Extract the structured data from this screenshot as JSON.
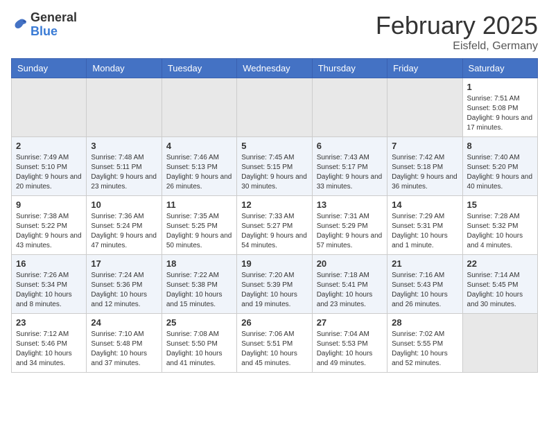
{
  "header": {
    "logo_general": "General",
    "logo_blue": "Blue",
    "month_title": "February 2025",
    "location": "Eisfeld, Germany"
  },
  "calendar": {
    "headers": [
      "Sunday",
      "Monday",
      "Tuesday",
      "Wednesday",
      "Thursday",
      "Friday",
      "Saturday"
    ],
    "weeks": [
      [
        {
          "day": "",
          "info": ""
        },
        {
          "day": "",
          "info": ""
        },
        {
          "day": "",
          "info": ""
        },
        {
          "day": "",
          "info": ""
        },
        {
          "day": "",
          "info": ""
        },
        {
          "day": "",
          "info": ""
        },
        {
          "day": "1",
          "info": "Sunrise: 7:51 AM\nSunset: 5:08 PM\nDaylight: 9 hours and 17 minutes."
        }
      ],
      [
        {
          "day": "2",
          "info": "Sunrise: 7:49 AM\nSunset: 5:10 PM\nDaylight: 9 hours and 20 minutes."
        },
        {
          "day": "3",
          "info": "Sunrise: 7:48 AM\nSunset: 5:11 PM\nDaylight: 9 hours and 23 minutes."
        },
        {
          "day": "4",
          "info": "Sunrise: 7:46 AM\nSunset: 5:13 PM\nDaylight: 9 hours and 26 minutes."
        },
        {
          "day": "5",
          "info": "Sunrise: 7:45 AM\nSunset: 5:15 PM\nDaylight: 9 hours and 30 minutes."
        },
        {
          "day": "6",
          "info": "Sunrise: 7:43 AM\nSunset: 5:17 PM\nDaylight: 9 hours and 33 minutes."
        },
        {
          "day": "7",
          "info": "Sunrise: 7:42 AM\nSunset: 5:18 PM\nDaylight: 9 hours and 36 minutes."
        },
        {
          "day": "8",
          "info": "Sunrise: 7:40 AM\nSunset: 5:20 PM\nDaylight: 9 hours and 40 minutes."
        }
      ],
      [
        {
          "day": "9",
          "info": "Sunrise: 7:38 AM\nSunset: 5:22 PM\nDaylight: 9 hours and 43 minutes."
        },
        {
          "day": "10",
          "info": "Sunrise: 7:36 AM\nSunset: 5:24 PM\nDaylight: 9 hours and 47 minutes."
        },
        {
          "day": "11",
          "info": "Sunrise: 7:35 AM\nSunset: 5:25 PM\nDaylight: 9 hours and 50 minutes."
        },
        {
          "day": "12",
          "info": "Sunrise: 7:33 AM\nSunset: 5:27 PM\nDaylight: 9 hours and 54 minutes."
        },
        {
          "day": "13",
          "info": "Sunrise: 7:31 AM\nSunset: 5:29 PM\nDaylight: 9 hours and 57 minutes."
        },
        {
          "day": "14",
          "info": "Sunrise: 7:29 AM\nSunset: 5:31 PM\nDaylight: 10 hours and 1 minute."
        },
        {
          "day": "15",
          "info": "Sunrise: 7:28 AM\nSunset: 5:32 PM\nDaylight: 10 hours and 4 minutes."
        }
      ],
      [
        {
          "day": "16",
          "info": "Sunrise: 7:26 AM\nSunset: 5:34 PM\nDaylight: 10 hours and 8 minutes."
        },
        {
          "day": "17",
          "info": "Sunrise: 7:24 AM\nSunset: 5:36 PM\nDaylight: 10 hours and 12 minutes."
        },
        {
          "day": "18",
          "info": "Sunrise: 7:22 AM\nSunset: 5:38 PM\nDaylight: 10 hours and 15 minutes."
        },
        {
          "day": "19",
          "info": "Sunrise: 7:20 AM\nSunset: 5:39 PM\nDaylight: 10 hours and 19 minutes."
        },
        {
          "day": "20",
          "info": "Sunrise: 7:18 AM\nSunset: 5:41 PM\nDaylight: 10 hours and 23 minutes."
        },
        {
          "day": "21",
          "info": "Sunrise: 7:16 AM\nSunset: 5:43 PM\nDaylight: 10 hours and 26 minutes."
        },
        {
          "day": "22",
          "info": "Sunrise: 7:14 AM\nSunset: 5:45 PM\nDaylight: 10 hours and 30 minutes."
        }
      ],
      [
        {
          "day": "23",
          "info": "Sunrise: 7:12 AM\nSunset: 5:46 PM\nDaylight: 10 hours and 34 minutes."
        },
        {
          "day": "24",
          "info": "Sunrise: 7:10 AM\nSunset: 5:48 PM\nDaylight: 10 hours and 37 minutes."
        },
        {
          "day": "25",
          "info": "Sunrise: 7:08 AM\nSunset: 5:50 PM\nDaylight: 10 hours and 41 minutes."
        },
        {
          "day": "26",
          "info": "Sunrise: 7:06 AM\nSunset: 5:51 PM\nDaylight: 10 hours and 45 minutes."
        },
        {
          "day": "27",
          "info": "Sunrise: 7:04 AM\nSunset: 5:53 PM\nDaylight: 10 hours and 49 minutes."
        },
        {
          "day": "28",
          "info": "Sunrise: 7:02 AM\nSunset: 5:55 PM\nDaylight: 10 hours and 52 minutes."
        },
        {
          "day": "",
          "info": ""
        }
      ]
    ]
  }
}
